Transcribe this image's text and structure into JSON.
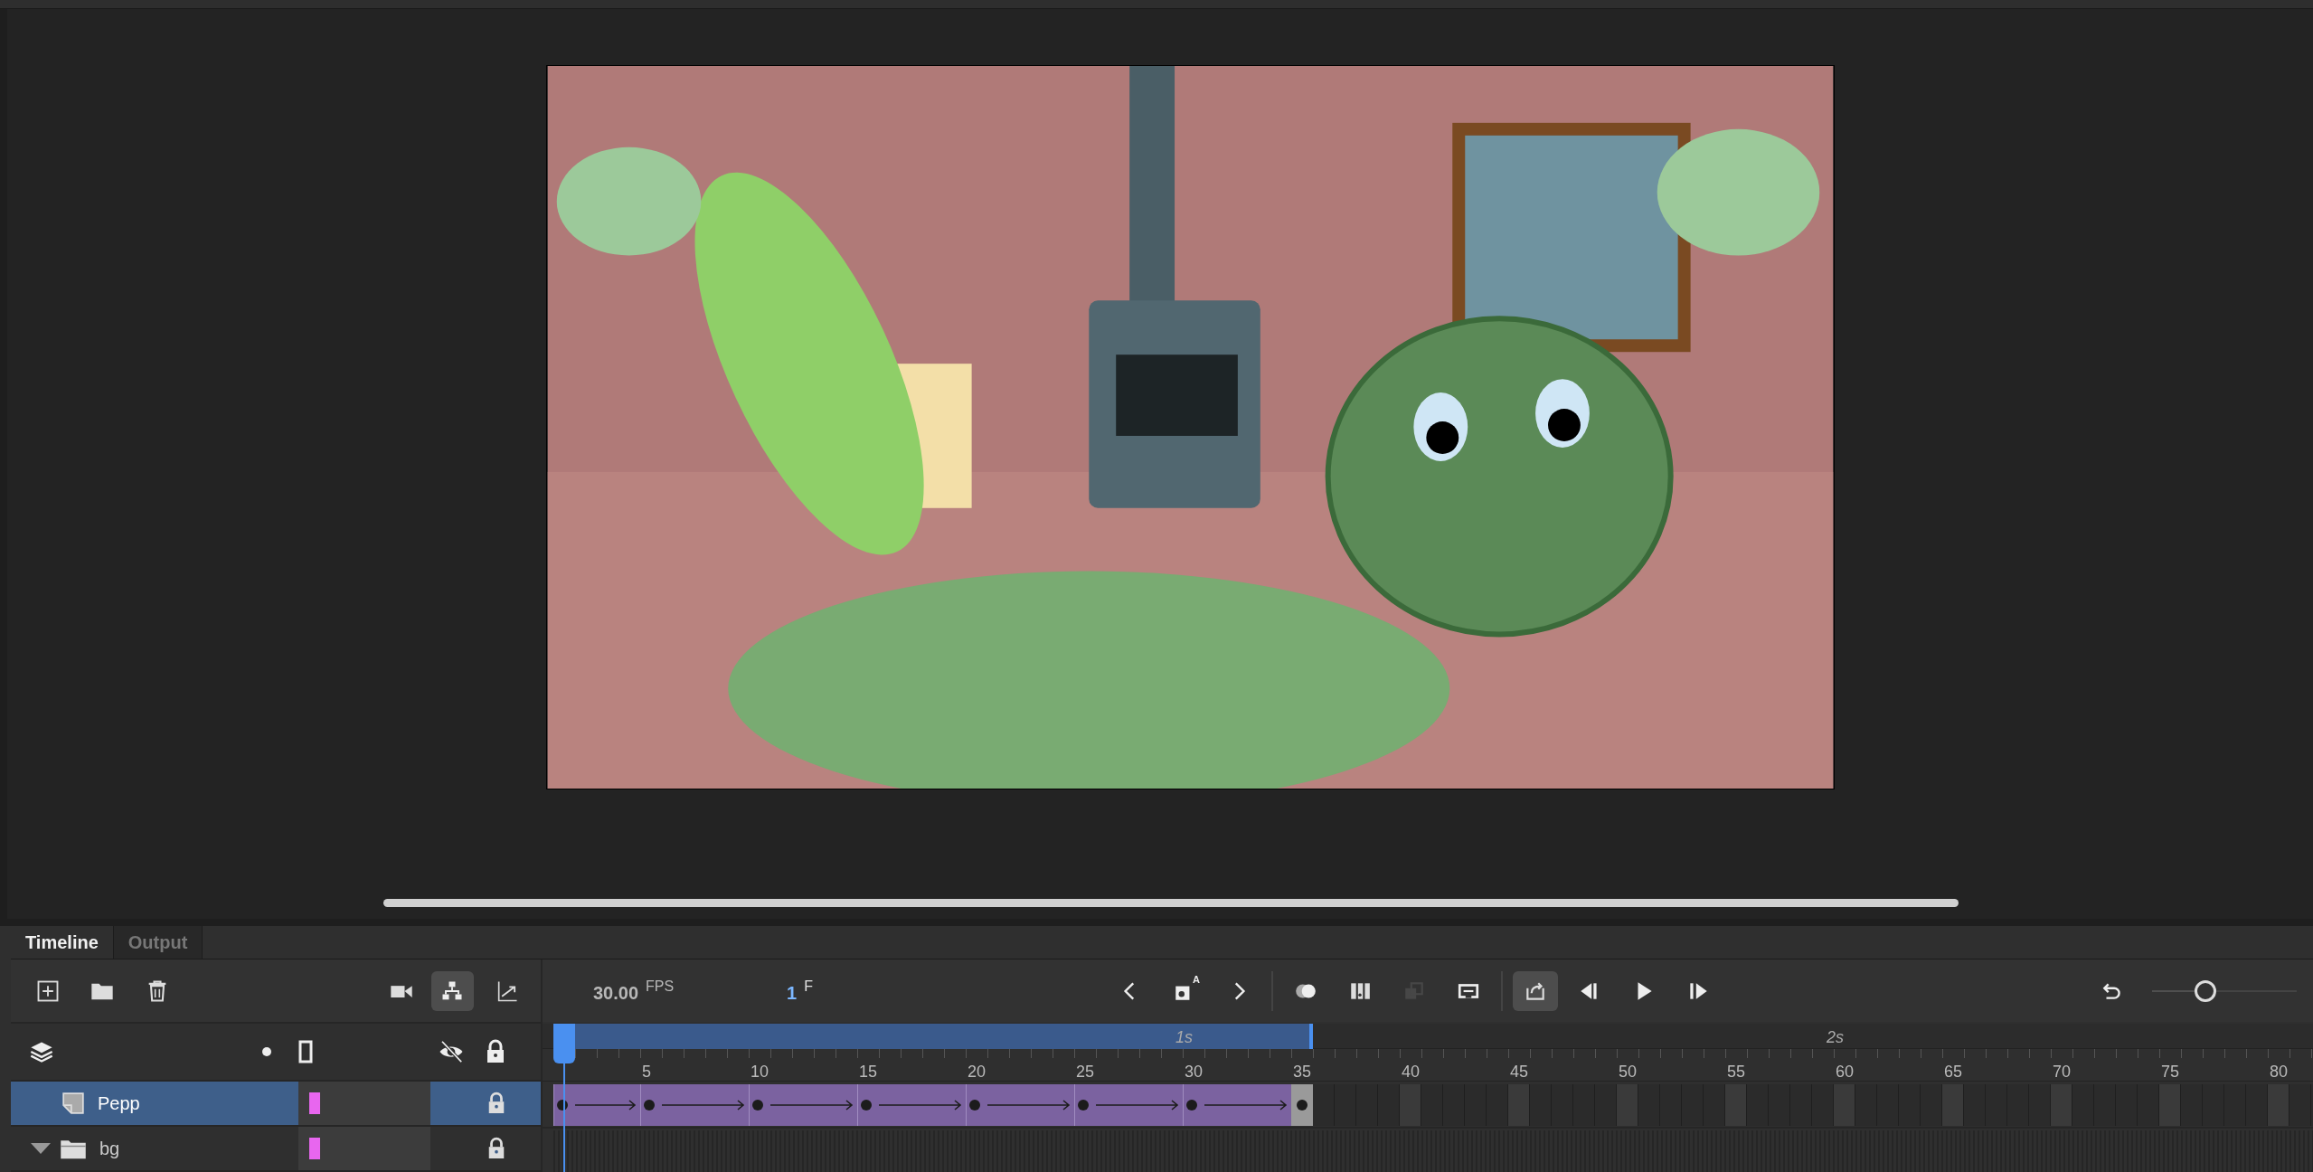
{
  "panel_tabs": [
    {
      "label": "Timeline",
      "selected": true
    },
    {
      "label": "Output",
      "selected": false
    }
  ],
  "layer_tools": [
    {
      "kind": "new-layer",
      "on": false
    },
    {
      "kind": "new-folder",
      "on": false
    },
    {
      "kind": "delete",
      "on": false
    },
    {
      "kind": "camera",
      "on": false
    },
    {
      "kind": "parenting",
      "on": true
    },
    {
      "kind": "graph",
      "on": false
    }
  ],
  "fps": {
    "value": "30.00",
    "unit": "FPS"
  },
  "current_frame": {
    "value": "1",
    "unit": "F"
  },
  "playback_tools": [
    {
      "kind": "previous",
      "on": false,
      "disabled": false
    },
    {
      "kind": "auto-keyframe",
      "on": false,
      "disabled": false,
      "badge": "A"
    },
    {
      "kind": "next",
      "on": false,
      "disabled": false
    },
    {
      "kind": "onion-skin",
      "on": false,
      "disabled": false
    },
    {
      "kind": "multiple-frames",
      "on": false,
      "disabled": false
    },
    {
      "kind": "paste-frames",
      "on": false,
      "disabled": true
    },
    {
      "kind": "center-frame",
      "on": false,
      "disabled": false
    },
    {
      "kind": "loop",
      "on": true,
      "disabled": false
    },
    {
      "kind": "step-back",
      "on": false,
      "disabled": false
    },
    {
      "kind": "play",
      "on": false,
      "disabled": false
    },
    {
      "kind": "step-forward",
      "on": false,
      "disabled": false
    }
  ],
  "zoom_slider": {
    "level": 0.37
  },
  "ruler": {
    "second_marks": [
      "1s",
      "2s"
    ],
    "frame_numbers": [
      "5",
      "10",
      "15",
      "20",
      "25",
      "30",
      "35",
      "40",
      "45",
      "50",
      "55",
      "60",
      "65",
      "70",
      "75",
      "80"
    ]
  },
  "layers": [
    {
      "name": "Pepp",
      "kind": "layer",
      "selected": true,
      "color": "#e866ef",
      "locked": true,
      "segments": [
        {
          "kind": "motion-tween"
        },
        {
          "kind": "motion-tween"
        },
        {
          "kind": "motion-tween"
        },
        {
          "kind": "motion-tween"
        },
        {
          "kind": "motion-tween"
        },
        {
          "kind": "motion-tween"
        },
        {
          "kind": "motion-tween"
        }
      ],
      "end_keyframe": true
    },
    {
      "name": "bg",
      "kind": "folder",
      "selected": false,
      "expanded": true,
      "color": "#e866ef",
      "locked": true
    }
  ]
}
